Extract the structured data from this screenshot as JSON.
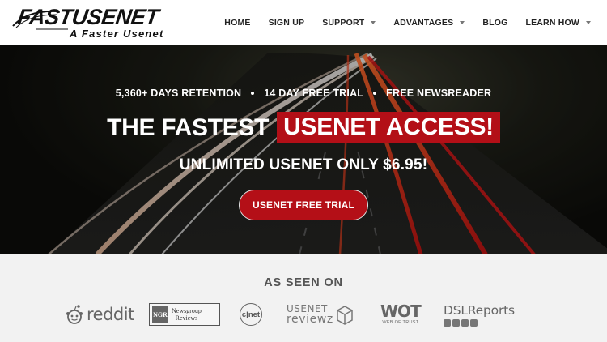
{
  "header": {
    "logo": {
      "main": "FASTUSENET",
      "tagline": "A Faster Usenet"
    },
    "nav": [
      {
        "label": "HOME",
        "dropdown": false
      },
      {
        "label": "SIGN UP",
        "dropdown": false
      },
      {
        "label": "SUPPORT",
        "dropdown": true
      },
      {
        "label": "ADVANTAGES",
        "dropdown": true
      },
      {
        "label": "BLOG",
        "dropdown": false
      },
      {
        "label": "LEARN HOW",
        "dropdown": true
      }
    ]
  },
  "hero": {
    "features": [
      "5,360+ DAYS RETENTION",
      "14 DAY FREE TRIAL",
      "FREE NEWSREADER"
    ],
    "headline_prefix": "THE FASTEST",
    "headline_highlight": "USENET ACCESS!",
    "subhead": "UNLIMITED USENET ONLY $6.95!",
    "cta_label": "USENET FREE TRIAL"
  },
  "seen_on": {
    "title": "AS SEEN ON",
    "brands": {
      "reddit": "reddit",
      "newsgroup_reviews_mark": "NGR",
      "newsgroup_reviews_line1": "Newsgroup",
      "newsgroup_reviews_line2": "Reviews",
      "cnet": "c|net",
      "usenet_reviewz_line1": "USENET",
      "usenet_reviewz_line2": "reviewz",
      "wot": "WOT",
      "wot_sub": "WEB OF TRUST",
      "dsl": "DSLReports"
    }
  },
  "colors": {
    "accent": "#b30f17",
    "hero_bg": "#0d0d0a",
    "seen_bg": "#f2f2f2"
  }
}
